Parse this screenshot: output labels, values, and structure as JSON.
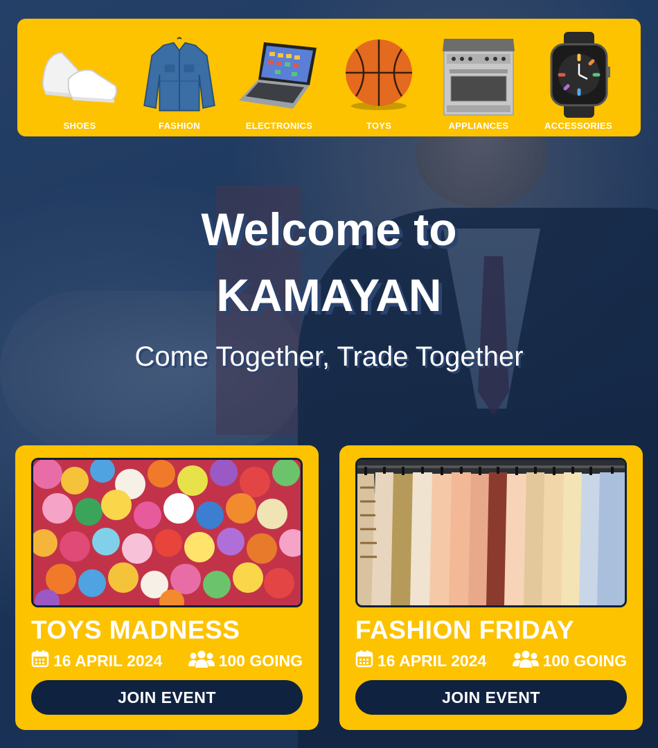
{
  "categories": [
    {
      "label": "SHOES",
      "icon": "shoe-icon"
    },
    {
      "label": "FASHION",
      "icon": "jacket-icon"
    },
    {
      "label": "ELECTRONICS",
      "icon": "laptop-icon"
    },
    {
      "label": "TOYS",
      "icon": "basketball-icon"
    },
    {
      "label": "APPLIANCES",
      "icon": "stove-icon"
    },
    {
      "label": "ACCESSORIES",
      "icon": "smartwatch-icon"
    }
  ],
  "hero": {
    "line1": "Welcome to",
    "line2": "KAMAYAN",
    "tagline": "Come Together, Trade Together"
  },
  "events": [
    {
      "title": "TOYS MADNESS",
      "date": "16 APRIL 2024",
      "going": "100 GOING",
      "button": "JOIN EVENT"
    },
    {
      "title": "FASHION FRIDAY",
      "date": "16 APRIL 2024",
      "going": "100 GOING",
      "button": "JOIN EVENT"
    }
  ],
  "colors": {
    "accent": "#fdc200",
    "navy": "#0f2240",
    "text": "#ffffff"
  }
}
